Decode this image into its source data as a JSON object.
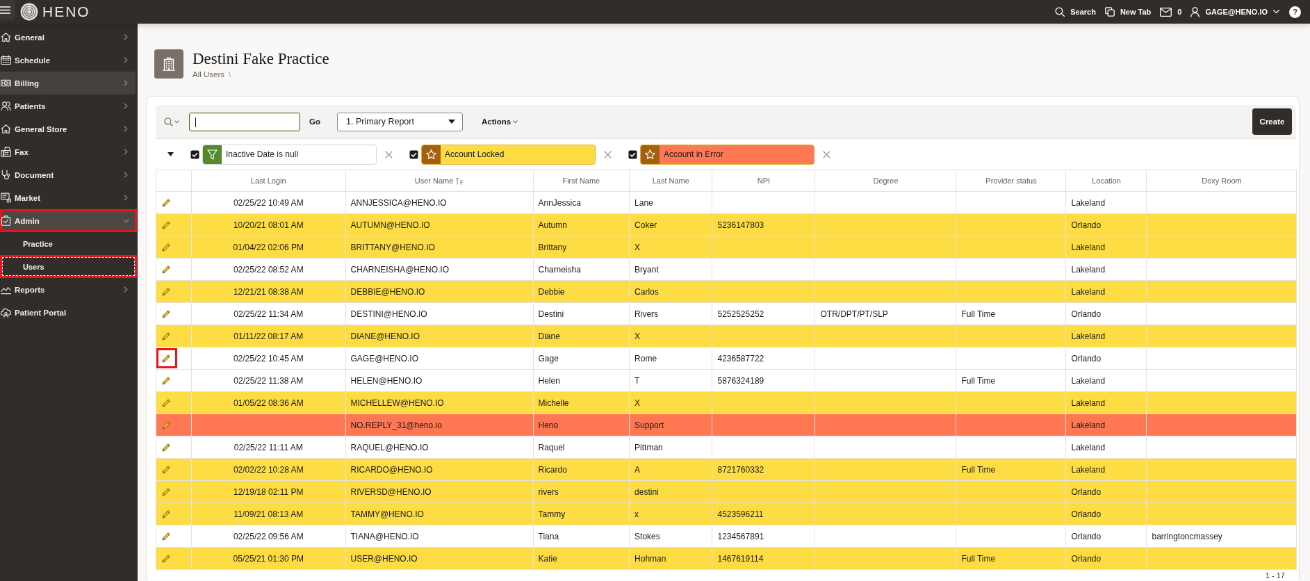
{
  "top_bar": {
    "brand": "HENO",
    "links": [
      {
        "kind": "search",
        "label": "Search"
      },
      {
        "kind": "new_tab",
        "label": "New Tab"
      },
      {
        "kind": "mail",
        "label": "0"
      },
      {
        "kind": "user",
        "label": "GAGE@HENO.IO"
      }
    ],
    "help": "?"
  },
  "sidebar": {
    "items": [
      {
        "label": "General",
        "expandable": true,
        "expanded": false,
        "hovered": false,
        "annotated": false
      },
      {
        "label": "Schedule",
        "expandable": true,
        "expanded": false,
        "hovered": false,
        "annotated": false
      },
      {
        "label": "Billing",
        "expandable": true,
        "expanded": false,
        "hovered": true,
        "annotated": false
      },
      {
        "label": "Patients",
        "expandable": true,
        "expanded": false,
        "hovered": false,
        "annotated": false
      },
      {
        "label": "General Store",
        "expandable": true,
        "expanded": false,
        "hovered": false,
        "annotated": false
      },
      {
        "label": "Fax",
        "expandable": true,
        "expanded": false,
        "hovered": false,
        "annotated": false
      },
      {
        "label": "Document",
        "expandable": true,
        "expanded": false,
        "hovered": false,
        "annotated": false
      },
      {
        "label": "Market",
        "expandable": true,
        "expanded": false,
        "hovered": false,
        "annotated": false
      },
      {
        "label": "Admin",
        "expandable": true,
        "expanded": true,
        "hovered": false,
        "annotated": true,
        "children": [
          {
            "label": "Practice",
            "annotated": false
          },
          {
            "label": "Users",
            "annotated": true
          }
        ]
      },
      {
        "label": "Reports",
        "expandable": true,
        "expanded": false,
        "hovered": false,
        "annotated": false
      },
      {
        "label": "Patient Portal",
        "expandable": false,
        "expanded": false,
        "hovered": false,
        "annotated": false
      }
    ]
  },
  "page": {
    "title": "Destini Fake Practice",
    "breadcrumb": [
      {
        "label": "All Users"
      }
    ],
    "breadcrumb_separator": "\\"
  },
  "toolbar": {
    "search": {
      "focused": true
    },
    "go_button": "Go",
    "report_select": "1. Primary Report",
    "actions_menu": "Actions",
    "create_button": "Create"
  },
  "filters": {
    "expanded": true,
    "items": [
      {
        "kind": "filter",
        "label": "Inactive Date is null",
        "checked": true
      },
      {
        "kind": "highlight",
        "label": "Account Locked",
        "checked": true,
        "color": "#fddc44"
      },
      {
        "kind": "highlight",
        "label": "Account in Error",
        "checked": true,
        "color": "#ff7853"
      }
    ]
  },
  "table": {
    "columns": [
      {
        "label": "Last Login",
        "sorted": false
      },
      {
        "label": "User Name",
        "sorted": true
      },
      {
        "label": "First Name",
        "sorted": false
      },
      {
        "label": "Last Name",
        "sorted": false
      },
      {
        "label": "NPI",
        "sorted": false
      },
      {
        "label": "Degree",
        "sorted": false
      },
      {
        "label": "Provider status",
        "sorted": false
      },
      {
        "label": "Location",
        "sorted": false
      },
      {
        "label": "Doxy Room",
        "sorted": false
      }
    ],
    "rows": [
      {
        "color": "#ffffff",
        "annotated": false,
        "last_login": "02/25/22 10:49 AM",
        "user_name": "ANNJESSICA@HENO.IO",
        "first_name": "AnnJessica",
        "last_name": "Lane",
        "location": "Lakeland"
      },
      {
        "color": "#fddc44",
        "annotated": false,
        "last_login": "10/20/21 08:01 AM",
        "user_name": "AUTUMN@HENO.IO",
        "first_name": "Autumn",
        "last_name": "Coker",
        "npi": "5236147803",
        "location": "Orlando"
      },
      {
        "color": "#fddc44",
        "annotated": false,
        "last_login": "01/04/22 02:06 PM",
        "user_name": "BRITTANY@HENO.IO",
        "first_name": "Brittany",
        "last_name": "X",
        "location": "Lakeland"
      },
      {
        "color": "#ffffff",
        "annotated": false,
        "last_login": "02/25/22 08:52 AM",
        "user_name": "CHARNEISHA@HENO.IO",
        "first_name": "Charneisha",
        "last_name": "Bryant",
        "location": "Lakeland"
      },
      {
        "color": "#fddc44",
        "annotated": false,
        "last_login": "12/21/21 08:38 AM",
        "user_name": "DEBBIE@HENO.IO",
        "first_name": "Debbie",
        "last_name": "Carlos",
        "location": "Lakeland"
      },
      {
        "color": "#ffffff",
        "annotated": false,
        "last_login": "02/25/22 11:34 AM",
        "user_name": "DESTINI@HENO.IO",
        "first_name": "Destini",
        "last_name": "Rivers",
        "npi": "5252525252",
        "degree": "OTR/DPT/PT/SLP",
        "provider_status": "Full Time",
        "location": "Orlando"
      },
      {
        "color": "#fddc44",
        "annotated": false,
        "last_login": "01/11/22 08:17 AM",
        "user_name": "DIANE@HENO.IO",
        "first_name": "Diane",
        "last_name": "X",
        "location": "Lakeland"
      },
      {
        "color": "#ffffff",
        "annotated": true,
        "last_login": "02/25/22 10:45 AM",
        "user_name": "GAGE@HENO.IO",
        "first_name": "Gage",
        "last_name": "Rome",
        "npi": "4236587722",
        "location": "Orlando"
      },
      {
        "color": "#ffffff",
        "annotated": false,
        "last_login": "02/25/22 11:38 AM",
        "user_name": "HELEN@HENO.IO",
        "first_name": "Helen",
        "last_name": "T",
        "npi": "5876324189",
        "provider_status": "Full Time",
        "location": "Lakeland"
      },
      {
        "color": "#fddc44",
        "annotated": false,
        "last_login": "01/05/22 08:36 AM",
        "user_name": "MICHELLEW@HENO.IO",
        "first_name": "Michelle",
        "last_name": "X",
        "location": "Lakeland"
      },
      {
        "color": "#ff7853",
        "annotated": false,
        "user_name": "NO.REPLY_31@heno.io",
        "first_name": "Heno",
        "last_name": "Support",
        "location": "Lakeland"
      },
      {
        "color": "#ffffff",
        "annotated": false,
        "last_login": "02/25/22 11:11 AM",
        "user_name": "RAQUEL@HENO.IO",
        "first_name": "Raquel",
        "last_name": "Pittman",
        "location": "Lakeland"
      },
      {
        "color": "#fddc44",
        "annotated": false,
        "last_login": "02/02/22 10:28 AM",
        "user_name": "RICARDO@HENO.IO",
        "first_name": "Ricardo",
        "last_name": "A",
        "npi": "8721760332",
        "provider_status": "Full Time",
        "location": "Lakeland"
      },
      {
        "color": "#fddc44",
        "annotated": false,
        "last_login": "12/19/18 02:11 PM",
        "user_name": "RIVERSD@HENO.IO",
        "first_name": "rivers",
        "last_name": "destini",
        "location": "Orlando"
      },
      {
        "color": "#fddc44",
        "annotated": false,
        "last_login": "11/09/21 08:13 AM",
        "user_name": "TAMMY@HENO.IO",
        "first_name": "Tammy",
        "last_name": "x",
        "npi": "4523596211",
        "location": "Orlando"
      },
      {
        "color": "#ffffff",
        "annotated": false,
        "last_login": "02/25/22 09:56 AM",
        "user_name": "TIANA@HENO.IO",
        "first_name": "Tiana",
        "last_name": "Stokes",
        "npi": "1234567891",
        "location": "Orlando",
        "doxy_room": "barringtoncmassey"
      },
      {
        "color": "#fddc44",
        "annotated": false,
        "last_login": "05/25/21 01:30 PM",
        "user_name": "USER@HENO.IO",
        "first_name": "Katie",
        "last_name": "Hohman",
        "npi": "1467619114",
        "provider_status": "Full Time",
        "location": "Orlando"
      }
    ]
  },
  "pagination": "1 - 17"
}
